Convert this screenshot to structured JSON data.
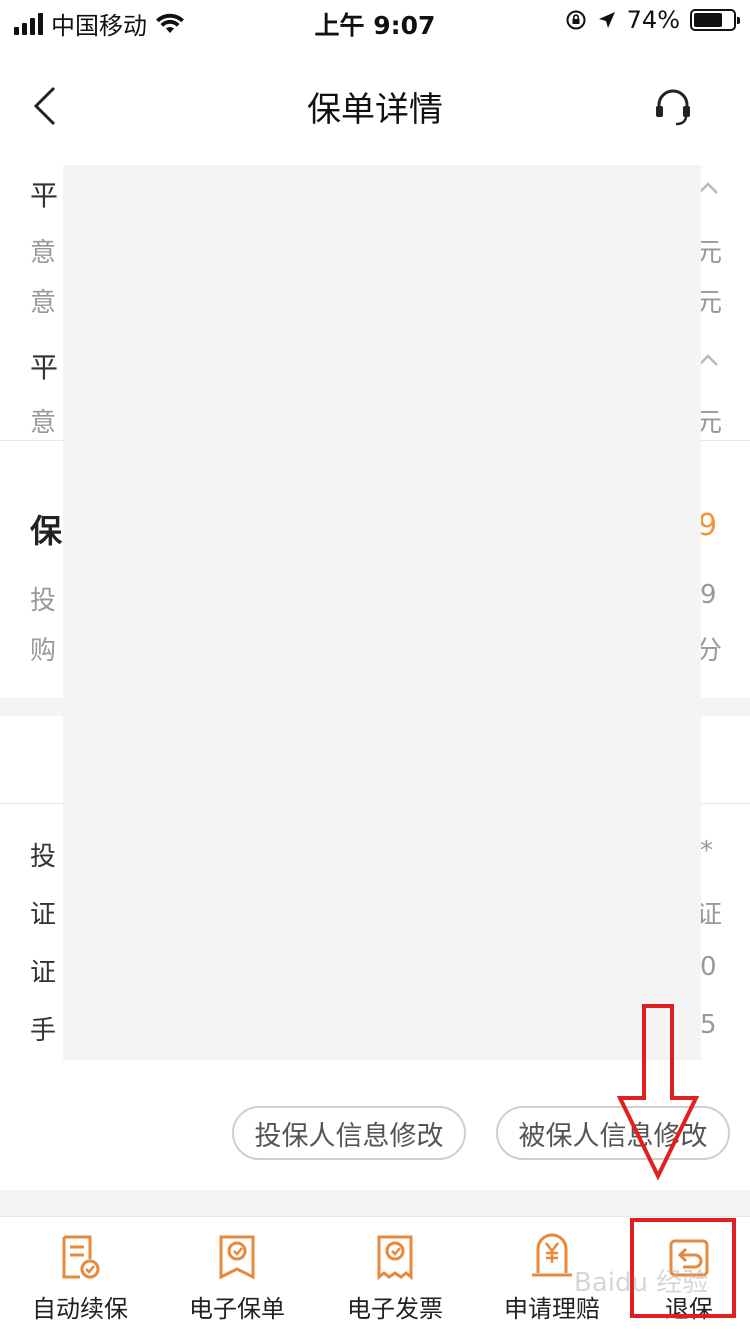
{
  "status_bar": {
    "carrier": "中国移动",
    "time": "上午 9:07",
    "battery_text": "74%",
    "battery_level": 0.74
  },
  "nav": {
    "title": "保单详情",
    "back_icon": "chevron-left-icon",
    "service_icon": "headset-icon"
  },
  "rows": {
    "r1": "平",
    "r2_left": "意",
    "r2_right": "元",
    "r3_left": "意",
    "r3_right": "元",
    "r4": "平",
    "r5_left": "意",
    "r5_right": "元",
    "r6_left": "保",
    "r6_right": "9",
    "r7_left": "投",
    "r7_right": "9",
    "r8_left": "购",
    "r8_right": "分",
    "r9_left": "投",
    "r9_right": "*",
    "r10_left": "证",
    "r10_right": "证",
    "r11_left": "证",
    "r11_right": "0",
    "r12_left": "手",
    "r12_right": "5"
  },
  "actions": {
    "edit_policyholder": "投保人信息修改",
    "edit_insured": "被保人信息修改"
  },
  "tabbar": {
    "items": [
      {
        "label": "自动续保",
        "icon": "auto-renew-icon"
      },
      {
        "label": "电子保单",
        "icon": "e-policy-icon"
      },
      {
        "label": "电子发票",
        "icon": "e-invoice-icon"
      },
      {
        "label": "申请理赔",
        "icon": "claim-icon"
      },
      {
        "label": "退保",
        "icon": "surrender-icon"
      }
    ]
  },
  "watermark": "Baidu 经验",
  "colors": {
    "accent": "#f0953a",
    "annotation": "#e02020"
  }
}
